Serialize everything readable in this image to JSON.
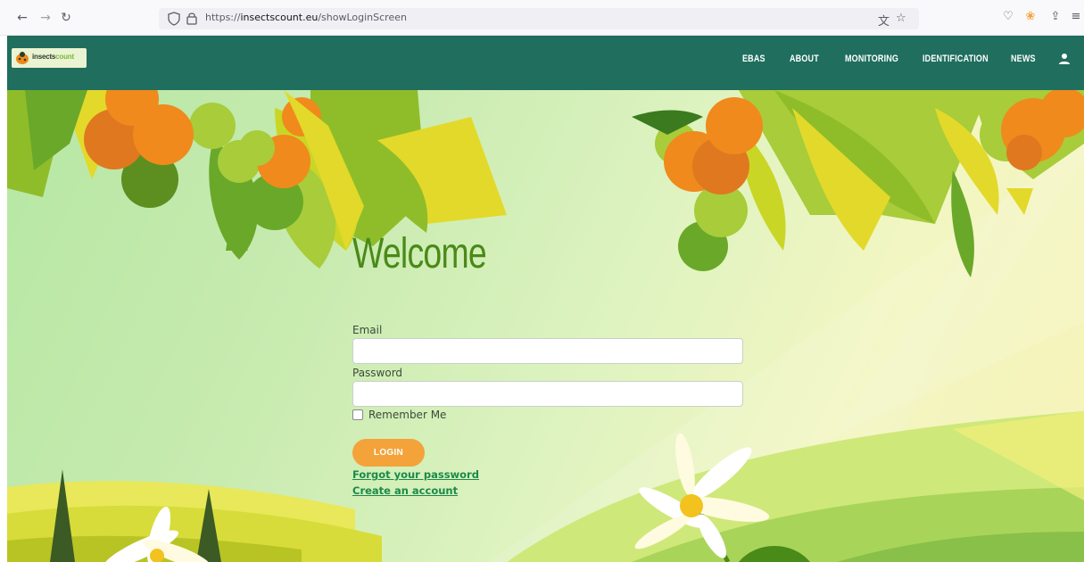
{
  "browser": {
    "url_prefix": "https://",
    "url_domain": "insectscount.eu",
    "url_path": "/showLoginScreen"
  },
  "site": {
    "logo_text_a": "insects",
    "logo_text_b": "count",
    "nav": [
      "EBAS",
      "ABOUT",
      "MONITORING",
      "IDENTIFICATION",
      "NEWS"
    ]
  },
  "login": {
    "title": "Welcome",
    "email_label": "Email",
    "email_value": "",
    "password_label": "Password",
    "password_value": "",
    "remember_label": "Remember Me",
    "remember_checked": false,
    "login_button": "LOGIN",
    "forgot_link": "Forgot your password",
    "create_link": "Create an account"
  },
  "colors": {
    "header_bg": "#1f6e5e",
    "title_green": "#4a8a18",
    "button_orange": "#f3a33a",
    "link_green": "#1b8a4a"
  }
}
